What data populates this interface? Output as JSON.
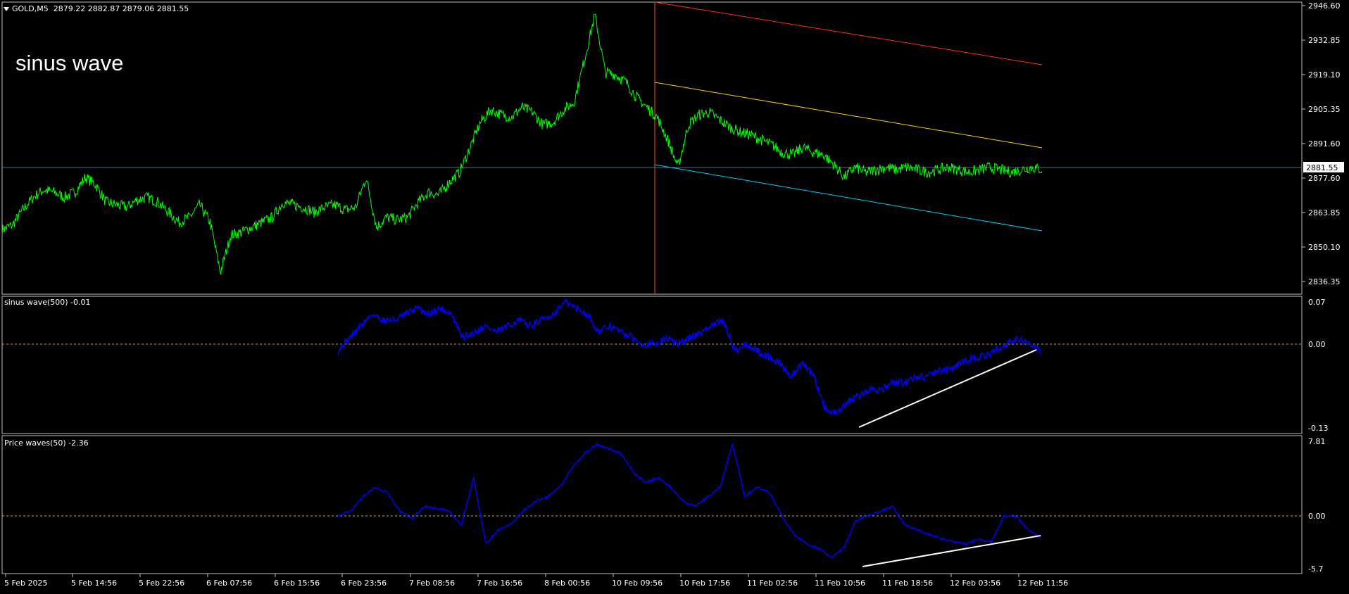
{
  "header": {
    "symbol": "GOLD,M5",
    "ohlc": "2879.22 2882.87 2879.06 2881.55"
  },
  "overlay_text": "sinus wave",
  "main_pane": {
    "y_ticks": [
      "2946.60",
      "2932.85",
      "2919.10",
      "2905.35",
      "2891.60",
      "2877.60",
      "2863.85",
      "2850.10",
      "2836.35"
    ],
    "current_price": "2881.55"
  },
  "pane2": {
    "label": "sinus wave(500) -0.01",
    "y_ticks": [
      "0.07",
      "0.00",
      "-0.13"
    ]
  },
  "pane3": {
    "label": "Price waves(50) -2.36",
    "y_ticks": [
      "7.81",
      "0.00",
      "-5.7"
    ]
  },
  "x_axis": {
    "labels": [
      "5 Feb 2025",
      "5 Feb 14:56",
      "5 Feb 22:56",
      "6 Feb 07:56",
      "6 Feb 15:56",
      "6 Feb 23:56",
      "7 Feb 08:56",
      "7 Feb 16:56",
      "8 Feb 00:56",
      "10 Feb 09:56",
      "10 Feb 17:56",
      "11 Feb 02:56",
      "11 Feb 10:56",
      "11 Feb 18:56",
      "12 Feb 03:56",
      "12 Feb 11:56"
    ]
  },
  "colors": {
    "background": "#000000",
    "price_line": "#00ff00",
    "indicator_line": "#0000ff",
    "channel_top": "#ff3300",
    "channel_mid": "#ffcc00",
    "channel_bottom": "#00ccff",
    "vertical_marker": "#ff4400",
    "price_hline": "#4a708b",
    "zero_line": "#ffa500",
    "trend_line": "#ffffff",
    "axis": "#c0c0c0"
  },
  "chart_data": [
    {
      "type": "line",
      "name": "GOLD,M5",
      "ylim": [
        2830,
        2950
      ],
      "x_index": [
        0,
        1,
        2,
        3,
        4,
        5,
        6,
        7,
        8,
        9,
        10,
        11,
        12,
        13,
        14,
        15,
        16,
        17,
        18,
        19,
        20,
        21,
        22,
        23,
        24,
        25,
        26,
        27,
        28,
        29,
        30,
        31,
        32,
        33,
        34,
        35,
        36,
        37,
        38,
        39,
        40,
        41,
        42,
        43,
        44,
        45,
        46,
        47,
        48,
        49,
        50,
        51,
        52,
        53,
        54,
        55,
        56,
        57,
        58,
        59,
        60,
        61,
        62,
        63,
        64,
        65,
        66,
        67,
        68,
        69,
        70,
        71,
        72,
        73,
        74,
        75,
        76,
        77,
        78,
        79,
        80,
        81,
        82,
        83,
        84,
        85,
        86,
        87,
        88,
        89,
        90,
        91,
        92,
        93,
        94,
        95,
        96,
        97,
        98,
        99,
        100
      ],
      "values": [
        2857,
        2859,
        2865,
        2870,
        2873,
        2872,
        2870,
        2872,
        2878,
        2875,
        2868,
        2867,
        2866,
        2869,
        2870,
        2868,
        2864,
        2860,
        2862,
        2867,
        2860,
        2840,
        2855,
        2856,
        2858,
        2860,
        2862,
        2868,
        2867,
        2866,
        2864,
        2866,
        2867,
        2865,
        2866,
        2878,
        2858,
        2862,
        2861,
        2862,
        2868,
        2872,
        2871,
        2876,
        2880,
        2890,
        2900,
        2905,
        2903,
        2902,
        2906,
        2904,
        2899,
        2900,
        2905,
        2908,
        2925,
        2943,
        2920,
        2919,
        2916,
        2910,
        2906,
        2902,
        2893,
        2882,
        2899,
        2903,
        2904,
        2901,
        2898,
        2896,
        2895,
        2893,
        2891,
        2888,
        2887,
        2890,
        2888,
        2887,
        2883,
        2878,
        2882,
        2880,
        2881,
        2882,
        2881,
        2882,
        2881,
        2880,
        2881,
        2882,
        2881,
        2880,
        2881,
        2882,
        2881,
        2880,
        2881,
        2882,
        2881
      ]
    },
    {
      "type": "line",
      "name": "sinus wave(500)",
      "ylim": [
        -0.13,
        0.07
      ],
      "values": [
        -0.01,
        0.01,
        0.03,
        0.05,
        0.04,
        0.04,
        0.05,
        0.06,
        0.05,
        0.06,
        0.05,
        0.01,
        0.02,
        0.03,
        0.02,
        0.03,
        0.04,
        0.03,
        0.04,
        0.05,
        0.07,
        0.06,
        0.05,
        0.02,
        0.03,
        0.02,
        0.01,
        0.0,
        0.0,
        0.01,
        0.0,
        0.01,
        0.02,
        0.03,
        0.04,
        -0.01,
        0.0,
        -0.01,
        -0.02,
        -0.03,
        -0.05,
        -0.03,
        -0.05,
        -0.1,
        -0.11,
        -0.09,
        -0.08,
        -0.07,
        -0.07,
        -0.06,
        -0.06,
        -0.05,
        -0.05,
        -0.04,
        -0.04,
        -0.03,
        -0.02,
        -0.02,
        -0.01,
        0.0,
        0.01,
        0.0,
        -0.01
      ]
    },
    {
      "type": "line",
      "name": "Price waves(50)",
      "ylim": [
        -5.7,
        7.81
      ],
      "values": [
        0.0,
        0.5,
        2.0,
        3.0,
        2.5,
        0.5,
        -0.3,
        1.0,
        0.8,
        0.5,
        -1.0,
        4.0,
        -3.0,
        -1.5,
        -1.0,
        0.5,
        1.5,
        2.0,
        3.0,
        5.0,
        6.5,
        7.5,
        7.0,
        6.5,
        4.5,
        3.5,
        4.0,
        3.0,
        1.5,
        1.0,
        2.0,
        3.0,
        7.5,
        2.0,
        3.0,
        2.5,
        0.0,
        -2.0,
        -3.0,
        -3.5,
        -4.5,
        -3.5,
        -0.5,
        0.0,
        0.5,
        1.0,
        -1.0,
        -1.5,
        -2.0,
        -2.5,
        -2.8,
        -3.0,
        -2.5,
        -2.8,
        0.0,
        0.0,
        -1.5,
        -2.36
      ]
    }
  ]
}
